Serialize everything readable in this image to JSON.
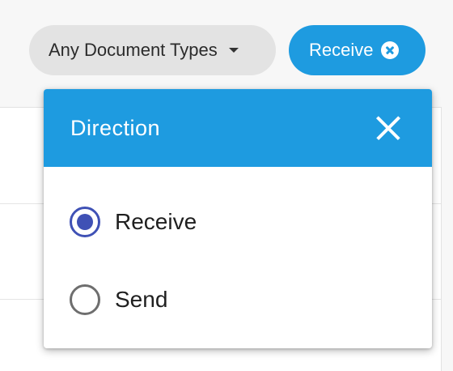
{
  "filters": {
    "doc_types_label": "Any Document Types",
    "direction_chip_label": "Receive"
  },
  "popup": {
    "title": "Direction",
    "options": [
      {
        "label": "Receive",
        "selected": true
      },
      {
        "label": "Send",
        "selected": false
      }
    ]
  },
  "icons": {
    "caret": "caret-down-icon",
    "chip_clear": "clear-circle-icon",
    "close": "close-icon"
  },
  "colors": {
    "accent": "#1e9be0",
    "radio_selected": "#3f51b5",
    "chip_neutral": "#e3e3e3"
  }
}
